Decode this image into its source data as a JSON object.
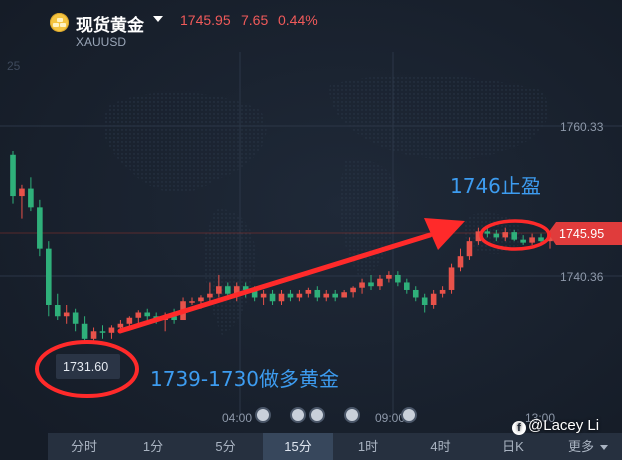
{
  "header": {
    "title": "现货黄金",
    "symbol": "XAUUSD",
    "price": "1745.95",
    "change": "7.65",
    "change_pct": "0.44%"
  },
  "colors": {
    "up": "#e8524a",
    "down": "#2fb07a",
    "annotation": "#ff2a2a",
    "label_blue": "#3d9cf0",
    "background": "#1a2230"
  },
  "chart_data": {
    "type": "candlestick",
    "y_axis_ticks": [
      "1760.33",
      "1740.36"
    ],
    "y_axis_partial": "25",
    "current_price_label": "1745.95",
    "low_label": "1731.60",
    "x_axis_ticks": [
      "04:00",
      "09:00",
      "13:00"
    ],
    "annotations": [
      "1746止盈",
      "1739-1730做多黄金"
    ],
    "ohlc": [
      [
        1756.5,
        1757.0,
        1750.0,
        1751.0
      ],
      [
        1751.0,
        1752.5,
        1748.0,
        1752.0
      ],
      [
        1752.0,
        1753.5,
        1749.0,
        1749.5
      ],
      [
        1749.5,
        1750.5,
        1743.0,
        1744.0
      ],
      [
        1744.0,
        1745.0,
        1735.0,
        1736.5
      ],
      [
        1736.5,
        1738.0,
        1734.5,
        1735.0
      ],
      [
        1735.0,
        1736.5,
        1734.0,
        1735.5
      ],
      [
        1735.5,
        1736.0,
        1733.0,
        1734.0
      ],
      [
        1734.0,
        1735.0,
        1731.6,
        1732.0
      ],
      [
        1732.0,
        1733.5,
        1731.8,
        1733.0
      ],
      [
        1733.0,
        1733.8,
        1732.0,
        1732.8
      ],
      [
        1732.8,
        1733.8,
        1732.0,
        1733.5
      ],
      [
        1733.5,
        1734.5,
        1733.0,
        1734.0
      ],
      [
        1734.0,
        1735.0,
        1733.5,
        1734.8
      ],
      [
        1734.8,
        1735.8,
        1734.0,
        1735.5
      ],
      [
        1735.5,
        1736.0,
        1734.5,
        1735.0
      ],
      [
        1735.0,
        1735.5,
        1734.0,
        1734.5
      ],
      [
        1734.5,
        1735.5,
        1733.0,
        1735.0
      ],
      [
        1735.0,
        1736.0,
        1734.0,
        1734.5
      ],
      [
        1734.5,
        1737.5,
        1734.5,
        1737.0
      ],
      [
        1737.0,
        1737.5,
        1736.5,
        1737.0
      ],
      [
        1737.0,
        1737.8,
        1736.0,
        1737.5
      ],
      [
        1737.5,
        1739.5,
        1737.0,
        1738.0
      ],
      [
        1738.0,
        1740.5,
        1737.5,
        1739.0
      ],
      [
        1739.0,
        1739.5,
        1737.5,
        1738.0
      ],
      [
        1738.0,
        1739.5,
        1737.0,
        1739.0
      ],
      [
        1739.0,
        1739.5,
        1737.5,
        1738.5
      ],
      [
        1738.5,
        1739.0,
        1737.0,
        1737.5
      ],
      [
        1737.5,
        1738.5,
        1736.5,
        1738.0
      ],
      [
        1738.0,
        1738.5,
        1736.5,
        1737.0
      ],
      [
        1737.0,
        1738.5,
        1736.5,
        1738.0
      ],
      [
        1738.0,
        1738.5,
        1737.0,
        1737.5
      ],
      [
        1737.5,
        1738.5,
        1737.0,
        1738.0
      ],
      [
        1738.0,
        1738.8,
        1737.5,
        1738.5
      ],
      [
        1738.5,
        1739.0,
        1737.0,
        1737.5
      ],
      [
        1737.5,
        1738.5,
        1737.0,
        1738.0
      ],
      [
        1738.0,
        1738.5,
        1737.0,
        1737.5
      ],
      [
        1737.5,
        1738.5,
        1737.5,
        1738.2
      ],
      [
        1738.2,
        1739.0,
        1737.5,
        1738.8
      ],
      [
        1738.8,
        1740.0,
        1738.0,
        1739.5
      ],
      [
        1739.5,
        1740.5,
        1738.5,
        1739.0
      ],
      [
        1739.0,
        1740.5,
        1738.5,
        1740.0
      ],
      [
        1740.0,
        1741.0,
        1739.5,
        1740.5
      ],
      [
        1740.5,
        1741.0,
        1739.0,
        1739.5
      ],
      [
        1739.5,
        1740.0,
        1738.0,
        1738.5
      ],
      [
        1738.5,
        1739.0,
        1737.0,
        1737.5
      ],
      [
        1737.5,
        1738.0,
        1735.5,
        1736.5
      ],
      [
        1736.5,
        1738.5,
        1736.0,
        1738.0
      ],
      [
        1738.0,
        1739.0,
        1737.5,
        1738.5
      ],
      [
        1738.5,
        1742.0,
        1738.0,
        1741.5
      ],
      [
        1741.5,
        1744.0,
        1741.0,
        1743.0
      ],
      [
        1743.0,
        1745.5,
        1742.5,
        1745.0
      ],
      [
        1745.0,
        1746.8,
        1744.5,
        1746.3
      ],
      [
        1746.3,
        1747.0,
        1745.5,
        1746.0
      ],
      [
        1746.0,
        1746.5,
        1745.0,
        1745.5
      ],
      [
        1745.5,
        1746.8,
        1745.0,
        1746.2
      ],
      [
        1746.2,
        1746.5,
        1745.0,
        1745.2
      ],
      [
        1745.2,
        1745.8,
        1744.5,
        1744.8
      ],
      [
        1744.8,
        1746.0,
        1744.5,
        1745.5
      ],
      [
        1745.5,
        1746.0,
        1744.5,
        1745.0
      ],
      [
        1745.0,
        1746.0,
        1744.0,
        1745.95
      ]
    ]
  },
  "tabs": [
    "分时",
    "1分",
    "5分",
    "15分",
    "1时",
    "4时",
    "日K",
    "更多"
  ],
  "active_tab": "15分",
  "watermark": "@Lacey Li"
}
